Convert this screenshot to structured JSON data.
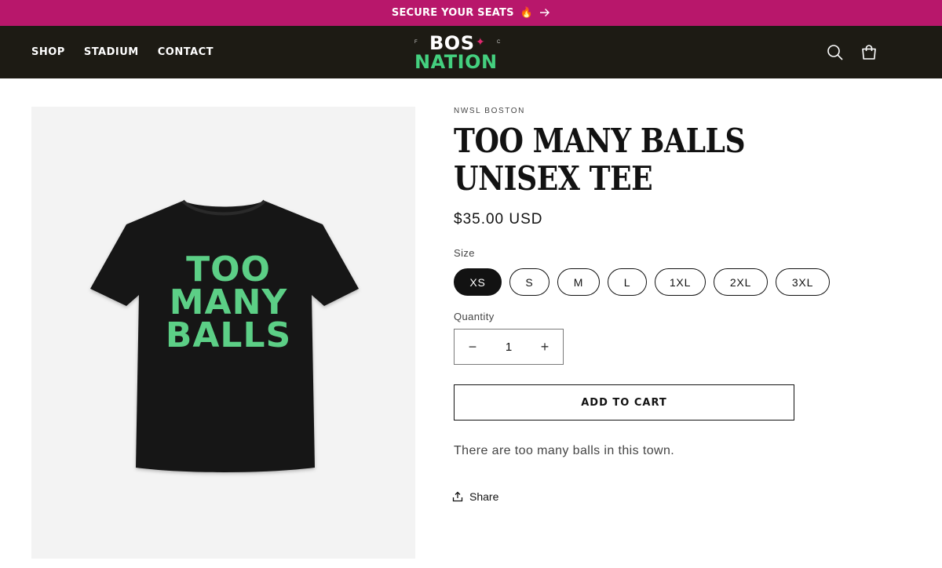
{
  "announcement": {
    "text": "SECURE YOUR SEATS",
    "emoji": "🔥",
    "arrow_icon": "arrow-right-icon"
  },
  "header": {
    "nav": [
      {
        "label": "SHOP"
      },
      {
        "label": "STADIUM"
      },
      {
        "label": "CONTACT"
      }
    ],
    "logo": {
      "line1": "BOS",
      "line2": "NATION",
      "small_left": "F",
      "small_right": "C"
    },
    "icons": {
      "search": "search-icon",
      "cart": "cart-icon"
    }
  },
  "colors": {
    "announcement_bg": "#b8176b",
    "header_bg": "#1d1b14",
    "logo_green": "#44d07f",
    "logo_star": "#e0286f",
    "shirt_text_green": "#5ccf86"
  },
  "product": {
    "vendor": "NWSL BOSTON",
    "title": "TOO MANY BALLS UNISEX TEE",
    "price": "$35.00 USD",
    "image": {
      "shirt_text": [
        "TOO",
        "MANY",
        "BALLS"
      ]
    },
    "size_label": "Size",
    "sizes": [
      "XS",
      "S",
      "M",
      "L",
      "1XL",
      "2XL",
      "3XL"
    ],
    "selected_size": "XS",
    "quantity_label": "Quantity",
    "quantity": "1",
    "minus": "−",
    "plus": "+",
    "add_to_cart": "ADD TO CART",
    "description": "There are too many balls in this town.",
    "share": "Share"
  }
}
